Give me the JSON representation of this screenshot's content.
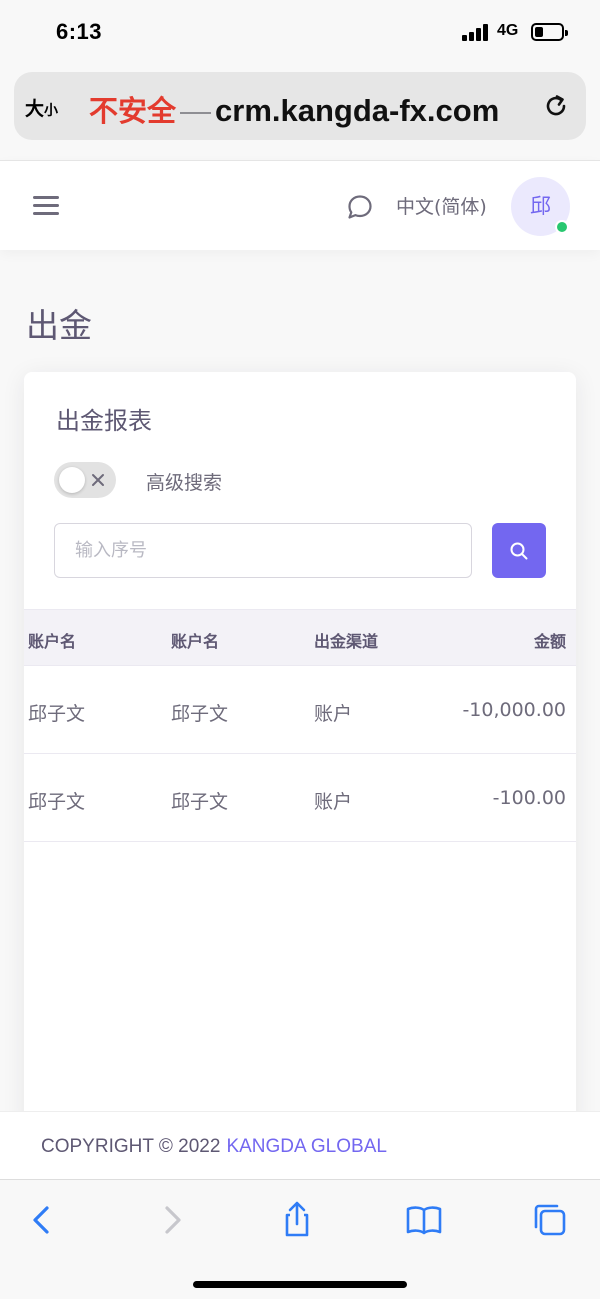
{
  "status_bar": {
    "time": "6:13",
    "network": "4G",
    "battery_level": 0.3
  },
  "browser": {
    "text_size_big": "大",
    "text_size_small": "小",
    "security_label": "不安全",
    "separator": "—",
    "domain": "crm.kangda-fx.com"
  },
  "header": {
    "language": "中文(简体)",
    "avatar_initial": "邱",
    "user_status_color": "#28c76f"
  },
  "page": {
    "title": "出金"
  },
  "card": {
    "title": "出金报表",
    "advanced_search_label": "高级搜索",
    "advanced_search_enabled": false,
    "search_placeholder": "输入序号"
  },
  "table": {
    "columns": [
      "账户名",
      "账户名",
      "出金渠道",
      "金额"
    ],
    "rows": [
      [
        "邱子文",
        "邱子文",
        "账户",
        "-10,000.00"
      ],
      [
        "邱子文",
        "邱子文",
        "账户",
        "-100.00"
      ]
    ]
  },
  "footer": {
    "copyright": "COPYRIGHT © 2022",
    "brand": "KANGDA GLOBAL"
  },
  "colors": {
    "primary": "#7367f0",
    "insecure": "#e33b2e",
    "ios_blue": "#2f7cf6"
  }
}
